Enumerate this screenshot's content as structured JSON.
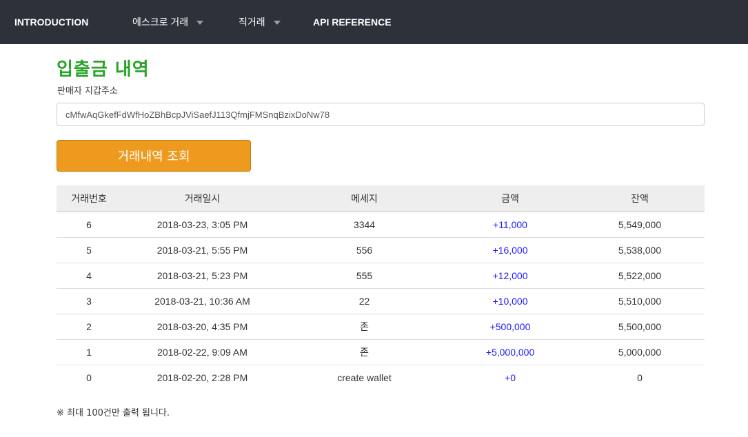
{
  "nav": {
    "introduction": "INTRODUCTION",
    "escrow": "에스크로 거래",
    "direct": "직거래",
    "api_reference": "API REFERENCE"
  },
  "page": {
    "title": "입출금 내역",
    "address_label": "판매자 지갑주소",
    "address_value": "cMfwAqGkefFdWfHoZBhBcpJViSaefJ113QfmjFMSnqBzixDoNw78",
    "search_button": "거래내역 조회",
    "note": "※ 최대 100건만 출력 됩니다."
  },
  "table": {
    "headers": [
      "거래번호",
      "거래일시",
      "메세지",
      "금액",
      "잔액"
    ],
    "rows": [
      [
        "6",
        "2018-03-23, 3:05 PM",
        "3344",
        "+11,000",
        "5,549,000"
      ],
      [
        "5",
        "2018-03-21, 5:55 PM",
        "556",
        "+16,000",
        "5,538,000"
      ],
      [
        "4",
        "2018-03-21, 5:23 PM",
        "555",
        "+12,000",
        "5,522,000"
      ],
      [
        "3",
        "2018-03-21, 10:36 AM",
        "22",
        "+10,000",
        "5,510,000"
      ],
      [
        "2",
        "2018-03-20, 4:35 PM",
        "존",
        "+500,000",
        "5,500,000"
      ],
      [
        "1",
        "2018-02-22, 9:09 AM",
        "존",
        "+5,000,000",
        "5,000,000"
      ],
      [
        "0",
        "2018-02-20, 2:28 PM",
        "create wallet",
        "+0",
        "0"
      ]
    ]
  },
  "colors": {
    "navbar_bg": "#2d3139",
    "title_green": "#28a428",
    "button_orange": "#ee9a1e",
    "amount_blue": "#1a1aff"
  }
}
